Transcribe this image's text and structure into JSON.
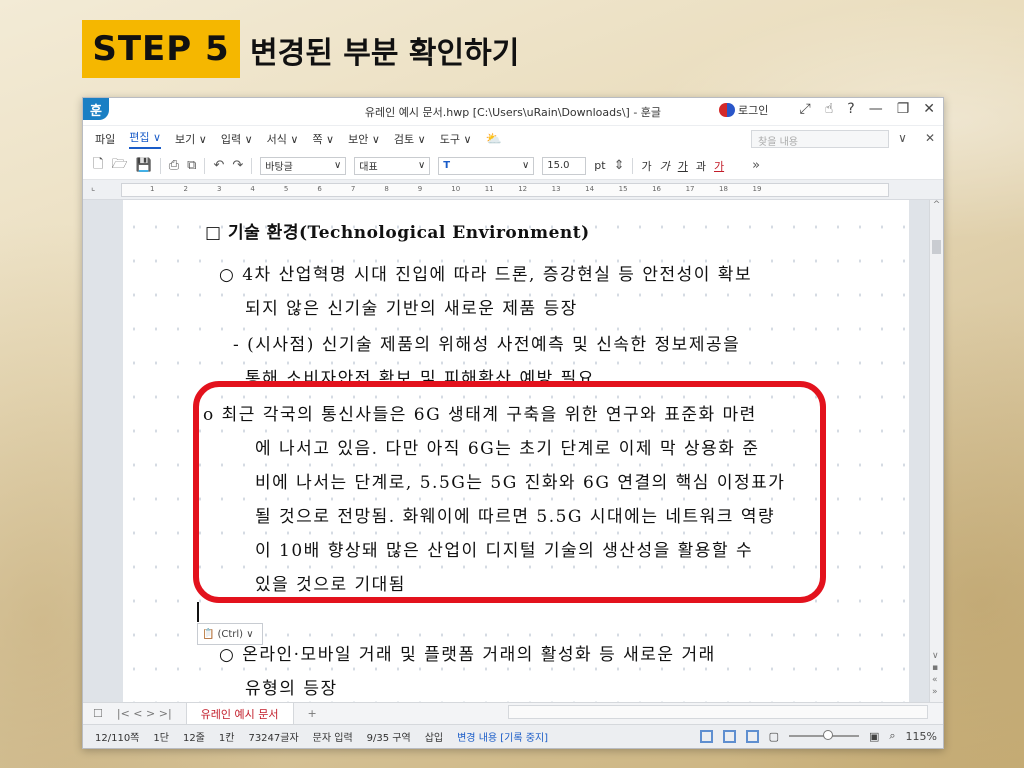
{
  "slide": {
    "step_badge": "STEP 5",
    "title": "변경된 부분 확인하기"
  },
  "window": {
    "app_logo": "훈",
    "title": "유레인 예시 문서.hwp [C:\\Users\\uRain\\Downloads\\] - 훈글",
    "login_label": "로그인",
    "title_icons": [
      "expand-arrows-icon",
      "hand-icon",
      "help-icon",
      "minimize-icon",
      "restore-icon",
      "close-icon"
    ]
  },
  "menubar": {
    "items": [
      {
        "label": "파일",
        "active": false
      },
      {
        "label": "편집 ∨",
        "active": true
      },
      {
        "label": "보기 ∨",
        "active": false
      },
      {
        "label": "입력 ∨",
        "active": false
      },
      {
        "label": "서식 ∨",
        "active": false
      },
      {
        "label": "쪽 ∨",
        "active": false
      },
      {
        "label": "보안 ∨",
        "active": false
      },
      {
        "label": "검토 ∨",
        "active": false
      },
      {
        "label": "도구 ∨",
        "active": false
      }
    ],
    "search_placeholder": "찾을 내용"
  },
  "toolbar": {
    "style_value": "바탕글",
    "font_type": "대표",
    "font_name": "T",
    "font_size": "15.0",
    "size_unit": "pt",
    "format_buttons": [
      "가",
      "가",
      "가",
      "과",
      "가"
    ]
  },
  "ruler": {
    "numbers": [
      "1",
      "2",
      "3",
      "4",
      "5",
      "6",
      "7",
      "8",
      "9",
      "10",
      "11",
      "12",
      "13",
      "14",
      "15",
      "16",
      "17",
      "18",
      "19"
    ]
  },
  "document": {
    "section_heading": "□ 기술 환경(Technological Environment)",
    "bullet1_line1": "○ 4차 산업혁명 시대 진입에 따라 드론, 증강현실 등 안전성이 확보",
    "bullet1_line2": "되지 않은 신기술 기반의 새로운 제품 등장",
    "implication_line1": "- (시사점) 신기술 제품의 위해성 사전예측 및 신속한 정보제공을",
    "implication_line2": "통해 소비자안전 확보 및 피해확산 예방 필요",
    "new_para_line1": "o 최근 각국의 통신사들은 6G 생태계 구축을 위한 연구와 표준화 마련",
    "new_para_line2": "에 나서고 있음. 다만 아직 6G는 초기 단계로 이제 막 상용화 준",
    "new_para_line3": "비에 나서는 단계로, 5.5G는 5G 진화와 6G 연결의 핵심 이정표가",
    "new_para_line4": "될 것으로 전망됨. 화웨이에 따르면 5.5G 시대에는 네트워크 역량",
    "new_para_line5": "이 10배 향상돼 많은 산업이 디지털 기술의 생산성을 활용할 수",
    "new_para_line6": "있을 것으로 기대됨",
    "ctrl_popup": "(Ctrl) ∨",
    "bullet2_line1": "○ 온라인·모바일 거래 및 플랫폼 거래의 활성화 등 새로운 거래",
    "bullet2_line2": "유형의 등장"
  },
  "tabbar": {
    "nav": "|< < > >|",
    "doc_tab": "유레인 예시 문서",
    "add_tab": "+"
  },
  "statusbar": {
    "page": "12/110쪽",
    "column": "1단",
    "line": "12줄",
    "col": "1칸",
    "chars": "73247글자",
    "mode": "문자 입력",
    "section": "9/35 구역",
    "insert": "삽입",
    "track_changes": "변경 내용 [기록 중지]",
    "zoom": "115%"
  },
  "colors": {
    "accent": "#f5b700",
    "highlight": "#e3121d",
    "active_menu": "#1a5cc8"
  }
}
